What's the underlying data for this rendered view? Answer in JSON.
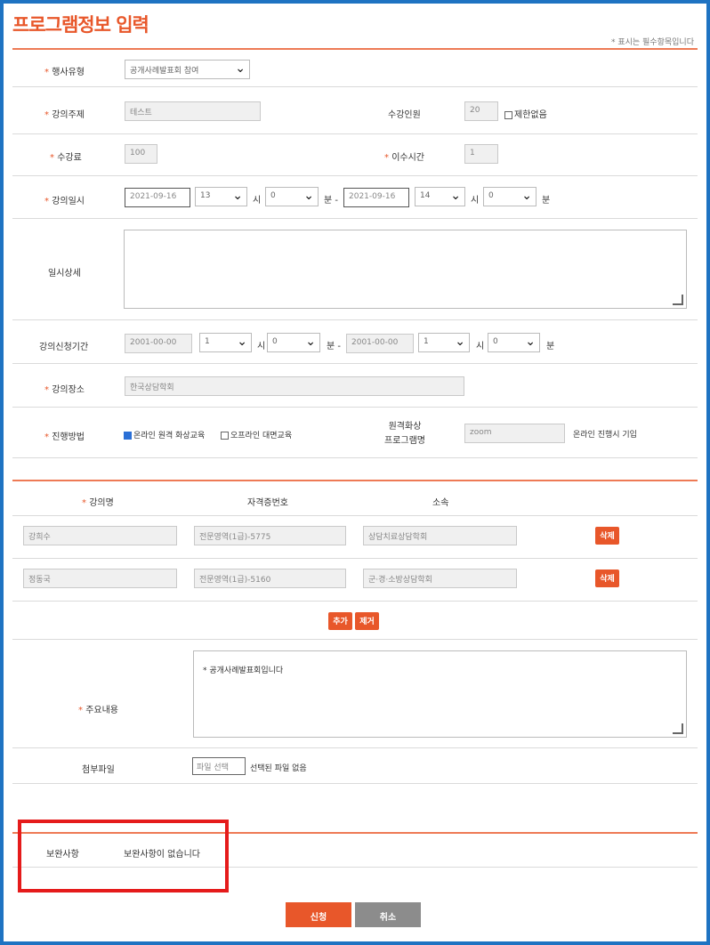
{
  "page": {
    "title": "프로그램정보 입력",
    "required_note": "* 표시는 필수항목입니다"
  },
  "fields": {
    "event_type": {
      "label": "행사유형",
      "value": "공개사례발표회 참여"
    },
    "topic": {
      "label": "강의주제",
      "value": "테스트"
    },
    "capacity": {
      "label": "수강인원",
      "value": "20",
      "limit_label": "제한없음"
    },
    "fee": {
      "label": "수강료",
      "value": "100"
    },
    "hours": {
      "label": "이수시간",
      "value": "1"
    },
    "datetime": {
      "label": "강의일시",
      "start_date": "2021-09-16",
      "start_hour": "13",
      "start_min": "0",
      "end_date": "2021-09-16",
      "end_hour": "14",
      "end_min": "0",
      "hour_unit": "시",
      "min_unit": "분",
      "sep": "분 -"
    },
    "detail": {
      "label": "일시상세"
    },
    "apply_period": {
      "label": "강의신청기간",
      "start_date": "2001-00-00",
      "start_hour": "1",
      "start_min": "0",
      "end_date": "2001-00-00",
      "end_hour": "1",
      "end_min": "0"
    },
    "place": {
      "label": "강의장소",
      "value": "한국상담학회"
    },
    "method": {
      "label": "진행방법",
      "online_label": "온라인 원격 화상교육",
      "offline_label": "오프라인 대면교육",
      "program_label_1": "원격화상",
      "program_label_2": "프로그램명",
      "program_value": "zoom",
      "program_note": "온라인 진행시 기입"
    }
  },
  "instructors": {
    "headers": [
      "강의명",
      "자격증번호",
      "소속"
    ],
    "rows": [
      {
        "name": "강희수",
        "license": "전문영역(1급)-5775",
        "org": "상담치료상담학회",
        "delete": "삭제"
      },
      {
        "name": "정동국",
        "license": "전문영역(1급)-5160",
        "org": "군·경·소방상담학회",
        "delete": "삭제"
      }
    ],
    "add_button": "추가",
    "remove_button": "제거"
  },
  "content": {
    "label": "주요내용",
    "value": "* 공개사례발표회입니다"
  },
  "attachment": {
    "label": "첨부파일",
    "button": "파일 선택",
    "status": "선택된 파일 없음"
  },
  "supplement": {
    "label": "보완사항",
    "value": "보완사항이 없습니다"
  },
  "actions": {
    "submit": "신청",
    "cancel": "취소"
  },
  "colors": {
    "accent": "#e8572a",
    "frame": "#1f73c2",
    "highlight": "#e51b1b"
  }
}
